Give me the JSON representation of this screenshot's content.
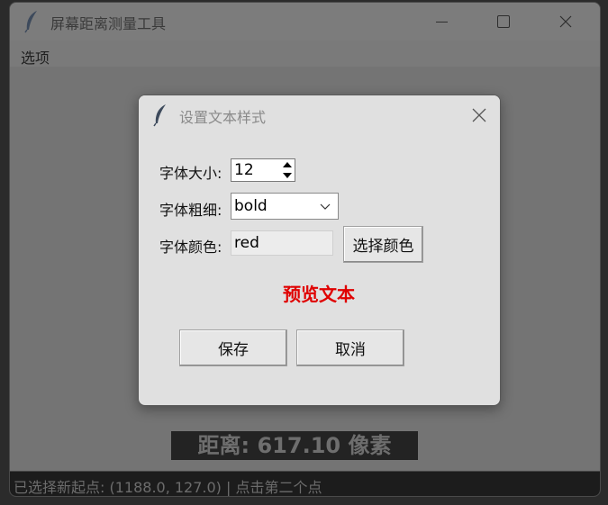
{
  "window": {
    "title": "屏幕距离测量工具"
  },
  "menu": {
    "options_label": "选项"
  },
  "distance": {
    "text": "距离: 617.10 像素"
  },
  "status": {
    "text": "已选择新起点: (1188.0, 127.0) | 点击第二个点"
  },
  "dialog": {
    "title": "设置文本样式",
    "font_size_label": "字体大小:",
    "font_size_value": "12",
    "font_weight_label": "字体粗细:",
    "font_weight_value": "bold",
    "font_color_label": "字体颜色:",
    "font_color_value": "red",
    "choose_color_button": "选择颜色",
    "preview_text": "预览文本",
    "save_button": "保存",
    "cancel_button": "取消"
  },
  "colors": {
    "preview": "#e00000",
    "dialog_bg": "#e0e0e0",
    "overlay": "#747474"
  },
  "icons": [
    "feather-icon",
    "minimize-icon",
    "maximize-icon",
    "close-icon",
    "spin-up-icon",
    "spin-down-icon",
    "chevron-down-icon"
  ]
}
